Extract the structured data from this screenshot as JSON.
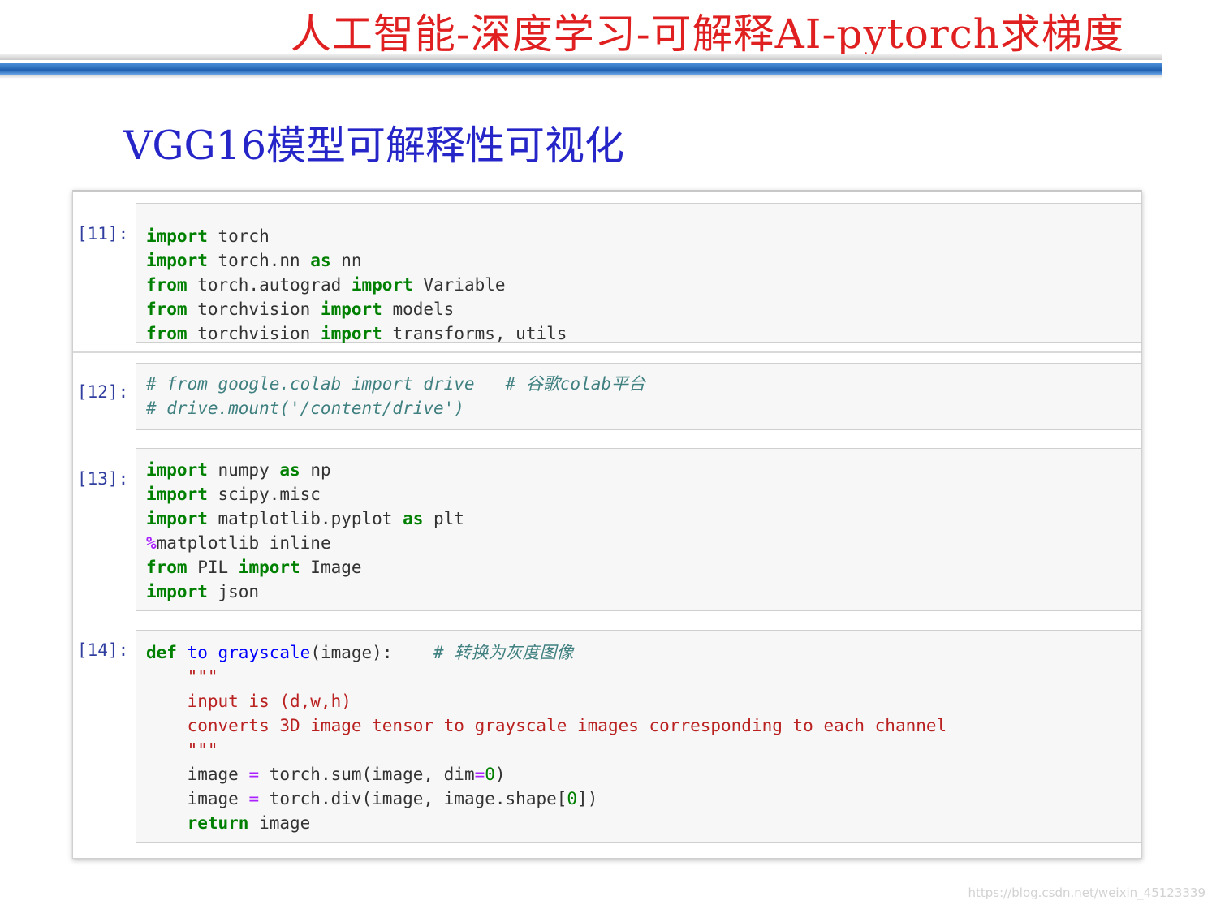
{
  "slide_title": "人工智能-深度学习-可解释AI-pytorch求梯度",
  "heading": "VGG16模型可解释性可视化",
  "watermark": "https://blog.csdn.net/weixin_45123339",
  "colors": {
    "title_red": "#e02020",
    "heading_blue": "#2525c8",
    "band_blue": "#1f5fb0",
    "prompt": "#303f9f"
  },
  "cells": [
    {
      "prompt": "[11]:",
      "lines": [
        [
          [
            "k",
            "import"
          ],
          [
            "p",
            " torch"
          ]
        ],
        [
          [
            "k",
            "import"
          ],
          [
            "p",
            " torch.nn "
          ],
          [
            "k",
            "as"
          ],
          [
            "p",
            " nn"
          ]
        ],
        [
          [
            "k",
            "from"
          ],
          [
            "p",
            " torch.autograd "
          ],
          [
            "k",
            "import"
          ],
          [
            "p",
            " Variable"
          ]
        ],
        [
          [
            "k",
            "from"
          ],
          [
            "p",
            " torchvision "
          ],
          [
            "k",
            "import"
          ],
          [
            "p",
            " models"
          ]
        ],
        [
          [
            "k",
            "from"
          ],
          [
            "p",
            " torchvision "
          ],
          [
            "k",
            "import"
          ],
          [
            "p",
            " transforms, utils"
          ]
        ]
      ]
    },
    {
      "prompt": "[12]:",
      "lines": [
        [
          [
            "c",
            "# from google.colab import drive   # 谷歌colab平台"
          ]
        ],
        [
          [
            "c",
            "# drive.mount('/content/drive')"
          ]
        ]
      ]
    },
    {
      "prompt": "[13]:",
      "lines": [
        [
          [
            "k",
            "import"
          ],
          [
            "p",
            " numpy "
          ],
          [
            "k",
            "as"
          ],
          [
            "p",
            " np"
          ]
        ],
        [
          [
            "k",
            "import"
          ],
          [
            "p",
            " scipy.misc"
          ]
        ],
        [
          [
            "k",
            "import"
          ],
          [
            "p",
            " matplotlib.pyplot "
          ],
          [
            "k",
            "as"
          ],
          [
            "p",
            " plt"
          ]
        ],
        [
          [
            "m",
            "%"
          ],
          [
            "p",
            "matplotlib inline"
          ]
        ],
        [
          [
            "k",
            "from"
          ],
          [
            "p",
            " PIL "
          ],
          [
            "k",
            "import"
          ],
          [
            "p",
            " Image"
          ]
        ],
        [
          [
            "k",
            "import"
          ],
          [
            "p",
            " json"
          ]
        ]
      ]
    },
    {
      "prompt": "[14]:",
      "lines": [
        [
          [
            "k",
            "def"
          ],
          [
            "p",
            " "
          ],
          [
            "f",
            "to_grayscale"
          ],
          [
            "p",
            "(image):    "
          ],
          [
            "c",
            "# 转换为灰度图像"
          ]
        ],
        [
          [
            "s",
            "    \"\"\""
          ]
        ],
        [
          [
            "s",
            "    input is (d,w,h)"
          ]
        ],
        [
          [
            "s",
            "    converts 3D image tensor to grayscale images corresponding to each channel"
          ]
        ],
        [
          [
            "s",
            "    \"\"\""
          ]
        ],
        [
          [
            "p",
            "    image "
          ],
          [
            "o",
            "="
          ],
          [
            "p",
            " torch.sum(image, dim"
          ],
          [
            "o",
            "="
          ],
          [
            "n",
            "0"
          ],
          [
            "p",
            ")"
          ]
        ],
        [
          [
            "p",
            "    image "
          ],
          [
            "o",
            "="
          ],
          [
            "p",
            " torch.div(image, image.shape["
          ],
          [
            "n",
            "0"
          ],
          [
            "p",
            "])"
          ]
        ],
        [
          [
            "p",
            "    "
          ],
          [
            "k",
            "return"
          ],
          [
            "p",
            " image"
          ]
        ]
      ]
    }
  ]
}
